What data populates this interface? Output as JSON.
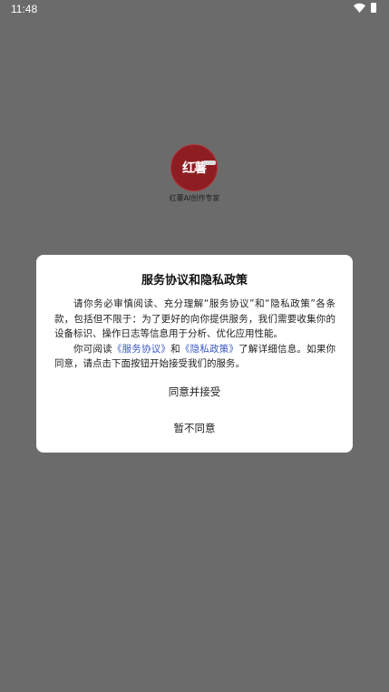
{
  "status_bar": {
    "time": "11:48"
  },
  "splash": {
    "logo_text": "红薯",
    "app_name": "红薯AI创作专家"
  },
  "dialog": {
    "title": "服务协议和隐私政策",
    "paragraph1": "请你务必审慎阅读、充分理解“服务协议”和“隐私政策”各条款，包括但不限于：为了更好的向你提供服务，我们需要收集你的设备标识、操作日志等信息用于分析、优化应用性能。",
    "p2_before": "你可阅读",
    "link_service": "《服务协议》",
    "p2_and": "和",
    "link_privacy": "《隐私政策》",
    "p2_after": "了解详细信息。如果你同意，请点击下面按钮开始接受我们的服务。",
    "agree_label": "同意并接受",
    "disagree_label": "暂不同意"
  },
  "colors": {
    "overlay": "#6b6b6b",
    "logo": "#8e1d22",
    "link": "#3a57c8"
  },
  "icons": [
    "wifi-icon",
    "battery-icon"
  ]
}
